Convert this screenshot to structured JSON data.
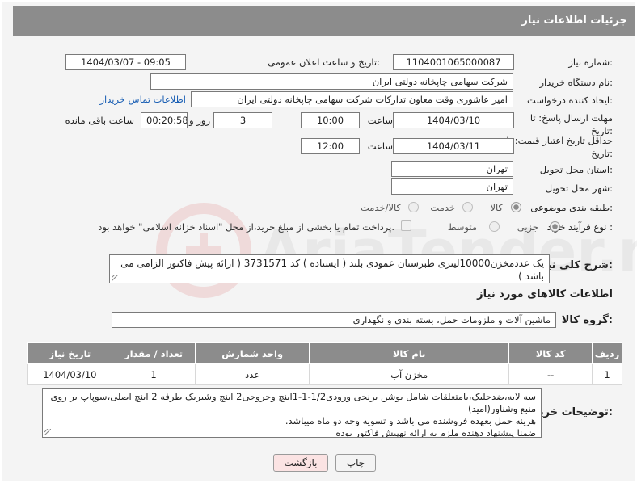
{
  "panel": {
    "title": "جزئیات اطلاعات نیاز"
  },
  "need_number": {
    "label": "شماره نیاز:",
    "value": "1104001065000087"
  },
  "announce_datetime": {
    "label": "تاریخ و ساعت اعلان عمومی:",
    "value": "1404/03/07 - 09:05"
  },
  "buyer_org": {
    "label": "نام دستگاه خریدار:",
    "value": "شرکت سهامی چاپخانه دولتی ایران"
  },
  "requester": {
    "label": "ایجاد کننده درخواست:",
    "value": "امیر عاشوری وقت معاون تدارکات شرکت سهامی چاپخانه دولتی ایران",
    "contact_link": "اطلاعات تماس خریدار"
  },
  "reply_deadline": {
    "label": "مهلت ارسال پاسخ: تا تاریخ:",
    "date": "1404/03/10",
    "time_label": "ساعت",
    "time": "10:00",
    "days": "3",
    "days_label": "روز و",
    "remaining": "00:20:58",
    "remaining_label": "ساعت باقی مانده"
  },
  "price_validity": {
    "label": "حداقل تاریخ اعتبار قیمت: تا تاریخ:",
    "date": "1404/03/11",
    "time_label": "ساعت",
    "time": "12:00"
  },
  "delivery_province": {
    "label": "استان محل تحویل:",
    "value": "تهران"
  },
  "delivery_city": {
    "label": "شهر محل تحویل:",
    "value": "تهران"
  },
  "category": {
    "label": "طبقه بندی موضوعی:",
    "options": [
      "کالا",
      "خدمت",
      "کالا/خدمت"
    ],
    "selected": "کالا"
  },
  "purchase_process": {
    "label": "نوع فرآیند خرید :",
    "options": [
      "جزیی",
      "متوسط"
    ],
    "selected": "جزیی",
    "payment_note": "پرداخت تمام یا بخشی از مبلغ خرید،از محل \"اسناد خزانه اسلامی\" خواهد بود."
  },
  "description": {
    "label": "شرح کلی نیاز:",
    "value": "یک عددمخزن10000لیتری طبرستان عمودی بلند ( ایستاده ) کد 3731571 ( ارائه پیش فاکتور الزامی می باشد )"
  },
  "goods_section_title": "اطلاعات کالاهای مورد نیاز",
  "goods_group": {
    "label": "گروه کالا:",
    "value": "ماشین آلات و ملزومات حمل، بسته بندی و نگهداری"
  },
  "goods_table": {
    "headers": [
      "ردیف",
      "کد کالا",
      "نام کالا",
      "واحد شمارش",
      "تعداد / مقدار",
      "تاریخ نیاز"
    ],
    "rows": [
      [
        "1",
        "--",
        "مخزن آب",
        "عدد",
        "1",
        "1404/03/10"
      ]
    ]
  },
  "buyer_notes": {
    "label": "توضیحات خریدار:",
    "lines": [
      "سه لایه،ضدجلبک،بامتعلقات شامل بوشن برنجی ورودی1/2-1-1اینچ وخروجی2 اینچ وشیربک طرفه 2 اینچ اصلی،سوپاپ بر روی منبع وشناور(امید)",
      "هزینه حمل بعهده فروشنده می باشد و تسویه وجه دو ماه میباشد.",
      "ضمنا پیشنهاد دهنده ملزم به ارائه نهپیش فاکتور بوده"
    ]
  },
  "buttons": {
    "print": "چاپ",
    "back": "بازگشت"
  },
  "watermark": {
    "text": "AriaTender.net"
  },
  "colors": {
    "header_bg": "#8c8c8c",
    "link": "#1a5fb4",
    "back_button_bg": "#fbe3e3"
  }
}
